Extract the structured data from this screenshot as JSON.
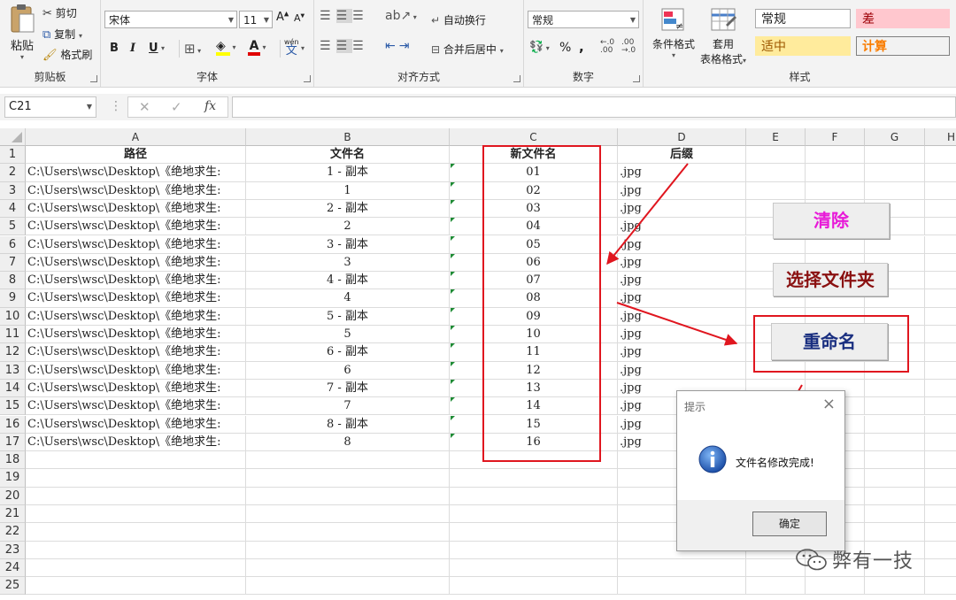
{
  "ribbon": {
    "clipboard": {
      "paste": "粘贴",
      "cut": "剪切",
      "copy": "复制",
      "format_painter": "格式刷",
      "label": "剪贴板"
    },
    "font": {
      "name": "宋体",
      "size": "11",
      "bold": "B",
      "italic": "I",
      "underline": "U",
      "font_color_glyph": "A",
      "wen": "wén",
      "wen2": "文",
      "label": "字体"
    },
    "alignment": {
      "wrap_text": "自动换行",
      "merge_center": "合并后居中",
      "label": "对齐方式"
    },
    "number": {
      "format": "常规",
      "percent": "%",
      "comma": ",",
      "label": "数字"
    },
    "styles": {
      "conditional": "条件格式",
      "table_format_1": "套用",
      "table_format_2": "表格格式",
      "normal": "常规",
      "bad": "差",
      "neutral": "适中",
      "calculation": "计算",
      "label": "样式"
    }
  },
  "formula_bar": {
    "name_box": "C21",
    "fx": "fx",
    "cancel": "✕",
    "enter": "✓",
    "value": ""
  },
  "grid": {
    "columns": [
      "A",
      "B",
      "C",
      "D",
      "E",
      "F",
      "G",
      "H"
    ],
    "headers": {
      "A": "路径",
      "B": "文件名",
      "C": "新文件名",
      "D": "后缀"
    },
    "row_numbers": [
      "1",
      "2",
      "3",
      "4",
      "5",
      "6",
      "7",
      "8",
      "9",
      "10",
      "11",
      "12",
      "13",
      "14",
      "15",
      "16",
      "17",
      "18",
      "19",
      "20",
      "21",
      "22",
      "23",
      "24",
      "25"
    ],
    "rows": [
      {
        "path": "C:\\Users\\wsc\\Desktop\\《绝地求生:",
        "name": "1 - 副本",
        "new": "01",
        "ext": ".jpg"
      },
      {
        "path": "C:\\Users\\wsc\\Desktop\\《绝地求生:",
        "name": "1",
        "new": "02",
        "ext": ".jpg"
      },
      {
        "path": "C:\\Users\\wsc\\Desktop\\《绝地求生:",
        "name": "2 - 副本",
        "new": "03",
        "ext": ".jpg"
      },
      {
        "path": "C:\\Users\\wsc\\Desktop\\《绝地求生:",
        "name": "2",
        "new": "04",
        "ext": ".jpg"
      },
      {
        "path": "C:\\Users\\wsc\\Desktop\\《绝地求生:",
        "name": "3 - 副本",
        "new": "05",
        "ext": ".jpg"
      },
      {
        "path": "C:\\Users\\wsc\\Desktop\\《绝地求生:",
        "name": "3",
        "new": "06",
        "ext": ".jpg"
      },
      {
        "path": "C:\\Users\\wsc\\Desktop\\《绝地求生:",
        "name": "4 - 副本",
        "new": "07",
        "ext": ".jpg"
      },
      {
        "path": "C:\\Users\\wsc\\Desktop\\《绝地求生:",
        "name": "4",
        "new": "08",
        "ext": ".jpg"
      },
      {
        "path": "C:\\Users\\wsc\\Desktop\\《绝地求生:",
        "name": "5 - 副本",
        "new": "09",
        "ext": ".jpg"
      },
      {
        "path": "C:\\Users\\wsc\\Desktop\\《绝地求生:",
        "name": "5",
        "new": "10",
        "ext": ".jpg"
      },
      {
        "path": "C:\\Users\\wsc\\Desktop\\《绝地求生:",
        "name": "6 - 副本",
        "new": "11",
        "ext": ".jpg"
      },
      {
        "path": "C:\\Users\\wsc\\Desktop\\《绝地求生:",
        "name": "6",
        "new": "12",
        "ext": ".jpg"
      },
      {
        "path": "C:\\Users\\wsc\\Desktop\\《绝地求生:",
        "name": "7 - 副本",
        "new": "13",
        "ext": ".jpg"
      },
      {
        "path": "C:\\Users\\wsc\\Desktop\\《绝地求生:",
        "name": "7",
        "new": "14",
        "ext": ".jpg"
      },
      {
        "path": "C:\\Users\\wsc\\Desktop\\《绝地求生:",
        "name": "8 - 副本",
        "new": "15",
        "ext": ".jpg"
      },
      {
        "path": "C:\\Users\\wsc\\Desktop\\《绝地求生:",
        "name": "8",
        "new": "16",
        "ext": ".jpg"
      }
    ]
  },
  "buttons": {
    "clear": "清除",
    "choose_folder": "选择文件夹",
    "rename": "重命名"
  },
  "dialog": {
    "title": "提示",
    "message": "文件名修改完成!",
    "ok": "确定",
    "close": "×"
  },
  "watermark": "弊有一技",
  "colors": {
    "annotation_red": "#e0161f",
    "clear_text": "#e81ad8",
    "folder_text": "#8a1010",
    "rename_text": "#1a2f80"
  }
}
